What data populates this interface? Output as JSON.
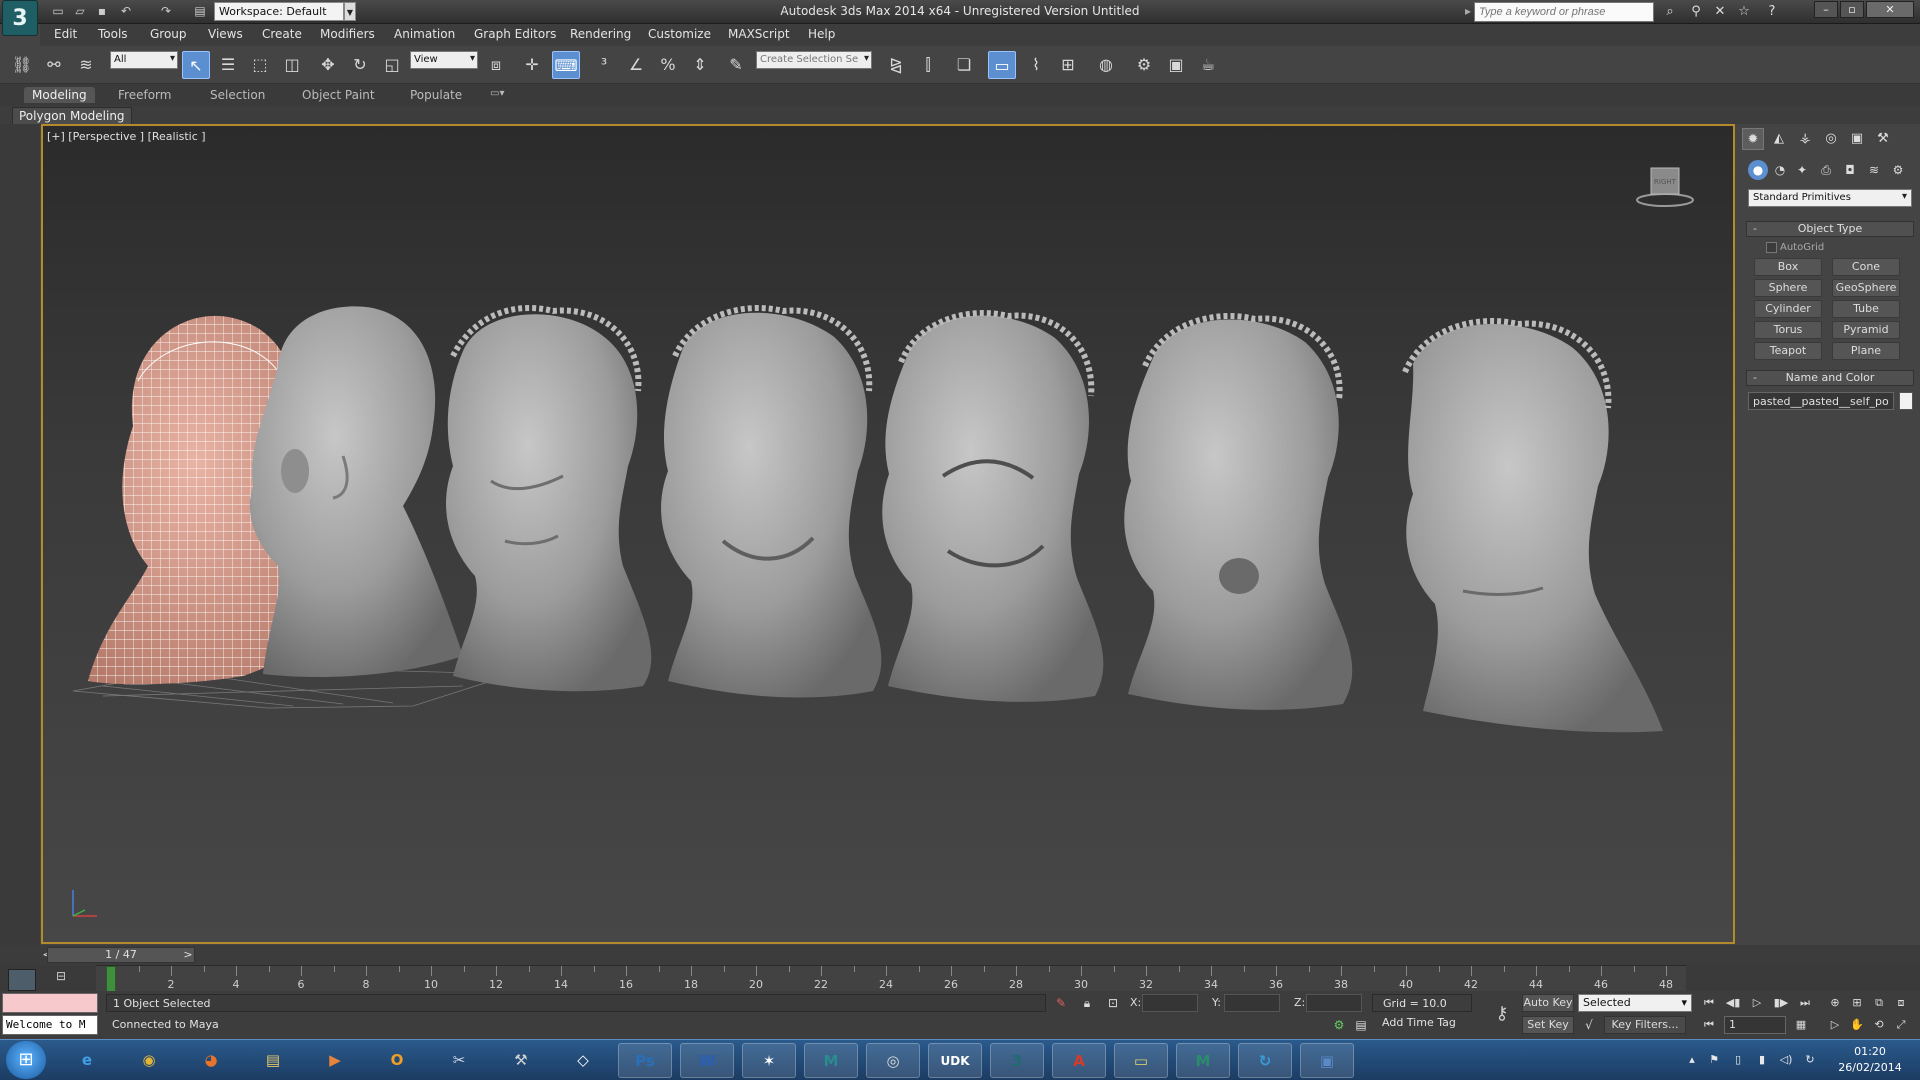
{
  "titlebar": {
    "workspace": "Workspace: Default",
    "title": "Autodesk 3ds Max  2014 x64  - Unregistered Version   Untitled",
    "search_placeholder": "Type a keyword or phrase"
  },
  "menu": [
    "Edit",
    "Tools",
    "Group",
    "Views",
    "Create",
    "Modifiers",
    "Animation",
    "Graph Editors",
    "Rendering",
    "Customize",
    "MAXScript",
    "Help"
  ],
  "toolbar": {
    "filter_value": "All",
    "refcoord_value": "View",
    "selection_set_placeholder": "Create Selection Se"
  },
  "ribbon": {
    "tabs": [
      "Modeling",
      "Freeform",
      "Selection",
      "Object Paint",
      "Populate"
    ],
    "active_tab": "Modeling",
    "panel_label": "Polygon Modeling"
  },
  "viewport": {
    "label": "[+] [Perspective ] [Realistic ]",
    "viewcube_label": "RIGHT"
  },
  "command_panel": {
    "category": "Standard Primitives",
    "object_type_title": "Object Type",
    "autogrid_label": "AutoGrid",
    "primitives": [
      "Box",
      "Cone",
      "Sphere",
      "GeoSphere",
      "Cylinder",
      "Tube",
      "Torus",
      "Pyramid",
      "Teapot",
      "Plane"
    ],
    "name_color_title": "Name and Color",
    "object_name": "pasted__pasted__self_po"
  },
  "timeline": {
    "slider_label": "1 / 47",
    "ticks": [
      "2",
      "4",
      "6",
      "8",
      "10",
      "12",
      "14",
      "16",
      "18",
      "20",
      "22",
      "24",
      "26",
      "28",
      "30",
      "32",
      "34",
      "36",
      "38",
      "40",
      "42",
      "44",
      "46",
      "48"
    ]
  },
  "status": {
    "maxscript_text": "Welcome to M",
    "selection_info": "1 Object Selected",
    "prompt": "Connected to Maya",
    "x_label": "X:",
    "y_label": "Y:",
    "z_label": "Z:",
    "grid": "Grid = 10.0",
    "add_time_tag": "Add Time Tag",
    "auto_key": "Auto Key",
    "set_key": "Set Key",
    "selected_dd": "Selected",
    "key_filters": "Key Filters...",
    "frame": "1"
  },
  "taskbar": {
    "time": "01:20",
    "date": "26/02/2014",
    "apps": [
      {
        "icon": "ie-icon",
        "glyph": "e",
        "color": "#3fa0e8"
      },
      {
        "icon": "chrome-icon",
        "glyph": "◉",
        "color": "#e2b43a"
      },
      {
        "icon": "firefox-icon",
        "glyph": "◕",
        "color": "#e8742a"
      },
      {
        "icon": "explorer-icon",
        "glyph": "▤",
        "color": "#e8c86a"
      },
      {
        "icon": "media-player-icon",
        "glyph": "▶",
        "color": "#e8843a"
      },
      {
        "icon": "outlook-icon",
        "glyph": "O",
        "color": "#f0a020"
      },
      {
        "icon": "snipping-icon",
        "glyph": "✂",
        "color": "#cfd8e6"
      },
      {
        "icon": "tool-icon",
        "glyph": "⚒",
        "color": "#cfcfcf"
      },
      {
        "icon": "unity-icon",
        "glyph": "◇",
        "color": "#ffffff"
      },
      {
        "icon": "photoshop-icon",
        "glyph": "Ps",
        "color": "#2b6fb8"
      },
      {
        "icon": "word-icon",
        "glyph": "W",
        "color": "#2a5fb5"
      },
      {
        "icon": "mixamo-icon",
        "glyph": "✶",
        "color": "#ffffff"
      },
      {
        "icon": "maya-icon",
        "glyph": "M",
        "color": "#2a8c8c"
      },
      {
        "icon": "eye-icon",
        "glyph": "◎",
        "color": "#dddddd"
      },
      {
        "icon": "udk-icon",
        "glyph": "UDK",
        "color": "#222222"
      },
      {
        "icon": "3dsmax-icon",
        "glyph": "3",
        "color": "#1f6b70"
      },
      {
        "icon": "autodesk-icon",
        "glyph": "A",
        "color": "#d83a2a"
      },
      {
        "icon": "notes-icon",
        "glyph": "▭",
        "color": "#d8d06a"
      },
      {
        "icon": "maya-alt-icon",
        "glyph": "M",
        "color": "#2a8c6a"
      },
      {
        "icon": "refresh-app-icon",
        "glyph": "↻",
        "color": "#3a9ad8"
      },
      {
        "icon": "window-app-icon",
        "glyph": "▣",
        "color": "#5a8ac8"
      }
    ]
  },
  "colors": {
    "viewport_border": "#b48b2c",
    "active_blue": "#5b8fd0",
    "mesh_gray": "#a9a9a9",
    "wireframe": "#ffffff",
    "skin": "#d89a88"
  }
}
